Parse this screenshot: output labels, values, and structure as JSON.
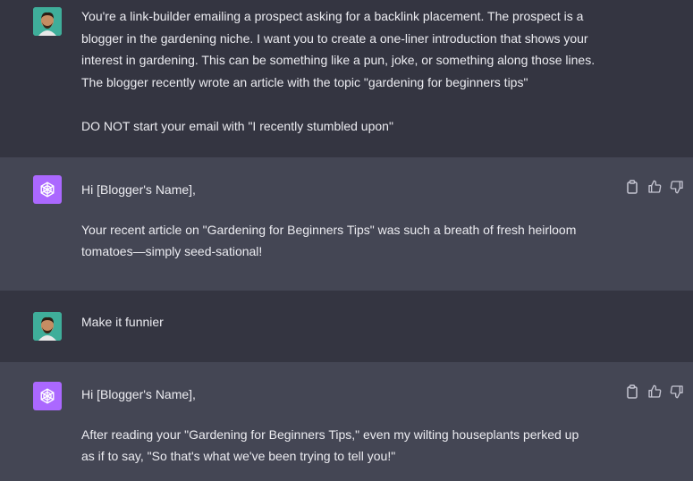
{
  "messages": [
    {
      "role": "user",
      "avatar_icon": "user-avatar-photo",
      "lines": [
        "You're a link-builder emailing a prospect asking for a backlink placement. The prospect is a",
        "blogger in the gardening niche. I want you to create a one-liner introduction that shows your",
        "interest in gardening. This can be something like a pun, joke, or something along those lines.",
        "The blogger recently wrote an article with the topic \"gardening for beginners tips\"",
        "",
        "DO NOT start your email with \"I recently stumbled upon\""
      ]
    },
    {
      "role": "assistant",
      "avatar_icon": "openai-logo-icon",
      "greeting": "Hi [Blogger's Name],",
      "body_lines": [
        "Your recent article on \"Gardening for Beginners Tips\" was such a breath of fresh heirloom",
        "tomatoes—simply seed-sational!"
      ],
      "actions": [
        "copy-icon",
        "thumbs-up-icon",
        "thumbs-down-icon"
      ]
    },
    {
      "role": "user",
      "avatar_icon": "user-avatar-photo",
      "lines": [
        "Make it funnier"
      ]
    },
    {
      "role": "assistant",
      "avatar_icon": "openai-logo-icon",
      "greeting": "Hi [Blogger's Name],",
      "body_lines": [
        "After reading your \"Gardening for Beginners Tips,\" even my wilting houseplants perked up",
        "as if to say, \"So that's what we've been trying to tell you!\""
      ],
      "actions": [
        "copy-icon",
        "thumbs-up-icon",
        "thumbs-down-icon"
      ]
    }
  ],
  "colors": {
    "user_bg": "#343541",
    "assistant_bg": "#444654",
    "gpt_avatar": "#ab68ff",
    "text": "#ececf1"
  }
}
